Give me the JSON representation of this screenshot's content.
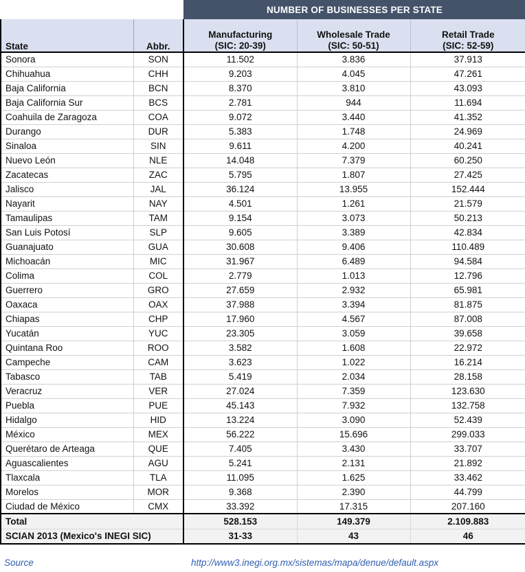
{
  "banner": {
    "title": "NUMBER OF BUSINESSES PER STATE"
  },
  "columns": {
    "state": "State",
    "abbr": "Abbr.",
    "manufacturing_line1": "Manufacturing",
    "manufacturing_line2": "(SIC: 20-39)",
    "wholesale_line1": "Wholesale Trade",
    "wholesale_line2": "(SIC: 50-51)",
    "retail_line1": "Retail Trade",
    "retail_line2": "(SIC: 52-59)"
  },
  "rows": [
    {
      "state": "Sonora",
      "abbr": "SON",
      "manufacturing": "11.502",
      "wholesale": "3.836",
      "retail": "37.913"
    },
    {
      "state": "Chihuahua",
      "abbr": "CHH",
      "manufacturing": "9.203",
      "wholesale": "4.045",
      "retail": "47.261"
    },
    {
      "state": "Baja California",
      "abbr": "BCN",
      "manufacturing": "8.370",
      "wholesale": "3.810",
      "retail": "43.093"
    },
    {
      "state": "Baja California Sur",
      "abbr": "BCS",
      "manufacturing": "2.781",
      "wholesale": "944",
      "retail": "11.694"
    },
    {
      "state": "Coahuila de Zaragoza",
      "abbr": "COA",
      "manufacturing": "9.072",
      "wholesale": "3.440",
      "retail": "41.352"
    },
    {
      "state": "Durango",
      "abbr": "DUR",
      "manufacturing": "5.383",
      "wholesale": "1.748",
      "retail": "24.969"
    },
    {
      "state": "Sinaloa",
      "abbr": "SIN",
      "manufacturing": "9.611",
      "wholesale": "4.200",
      "retail": "40.241"
    },
    {
      "state": "Nuevo León",
      "abbr": "NLE",
      "manufacturing": "14.048",
      "wholesale": "7.379",
      "retail": "60.250"
    },
    {
      "state": "Zacatecas",
      "abbr": "ZAC",
      "manufacturing": "5.795",
      "wholesale": "1.807",
      "retail": "27.425"
    },
    {
      "state": "Jalisco",
      "abbr": "JAL",
      "manufacturing": "36.124",
      "wholesale": "13.955",
      "retail": "152.444"
    },
    {
      "state": "Nayarit",
      "abbr": "NAY",
      "manufacturing": "4.501",
      "wholesale": "1.261",
      "retail": "21.579"
    },
    {
      "state": "Tamaulipas",
      "abbr": "TAM",
      "manufacturing": "9.154",
      "wholesale": "3.073",
      "retail": "50.213"
    },
    {
      "state": "San Luis Potosí",
      "abbr": "SLP",
      "manufacturing": "9.605",
      "wholesale": "3.389",
      "retail": "42.834"
    },
    {
      "state": "Guanajuato",
      "abbr": "GUA",
      "manufacturing": "30.608",
      "wholesale": "9.406",
      "retail": "110.489"
    },
    {
      "state": "Michoacán",
      "abbr": "MIC",
      "manufacturing": "31.967",
      "wholesale": "6.489",
      "retail": "94.584"
    },
    {
      "state": "Colima",
      "abbr": "COL",
      "manufacturing": "2.779",
      "wholesale": "1.013",
      "retail": "12.796"
    },
    {
      "state": "Guerrero",
      "abbr": "GRO",
      "manufacturing": "27.659",
      "wholesale": "2.932",
      "retail": "65.981"
    },
    {
      "state": "Oaxaca",
      "abbr": "OAX",
      "manufacturing": "37.988",
      "wholesale": "3.394",
      "retail": "81.875"
    },
    {
      "state": "Chiapas",
      "abbr": "CHP",
      "manufacturing": "17.960",
      "wholesale": "4.567",
      "retail": "87.008"
    },
    {
      "state": "Yucatán",
      "abbr": "YUC",
      "manufacturing": "23.305",
      "wholesale": "3.059",
      "retail": "39.658"
    },
    {
      "state": "Quintana Roo",
      "abbr": "ROO",
      "manufacturing": "3.582",
      "wholesale": "1.608",
      "retail": "22.972"
    },
    {
      "state": "Campeche",
      "abbr": "CAM",
      "manufacturing": "3.623",
      "wholesale": "1.022",
      "retail": "16.214"
    },
    {
      "state": "Tabasco",
      "abbr": "TAB",
      "manufacturing": "5.419",
      "wholesale": "2.034",
      "retail": "28.158"
    },
    {
      "state": "Veracruz",
      "abbr": "VER",
      "manufacturing": "27.024",
      "wholesale": "7.359",
      "retail": "123.630"
    },
    {
      "state": "Puebla",
      "abbr": "PUE",
      "manufacturing": "45.143",
      "wholesale": "7.932",
      "retail": "132.758"
    },
    {
      "state": "Hidalgo",
      "abbr": "HID",
      "manufacturing": "13.224",
      "wholesale": "3.090",
      "retail": "52.439"
    },
    {
      "state": "México",
      "abbr": "MEX",
      "manufacturing": "56.222",
      "wholesale": "15.696",
      "retail": "299.033"
    },
    {
      "state": "Querétaro de Arteaga",
      "abbr": "QUE",
      "manufacturing": "7.405",
      "wholesale": "3.430",
      "retail": "33.707"
    },
    {
      "state": "Aguascalientes",
      "abbr": "AGU",
      "manufacturing": "5.241",
      "wholesale": "2.131",
      "retail": "21.892"
    },
    {
      "state": "Tlaxcala",
      "abbr": "TLA",
      "manufacturing": "11.095",
      "wholesale": "1.625",
      "retail": "33.462"
    },
    {
      "state": "Morelos",
      "abbr": "MOR",
      "manufacturing": "9.368",
      "wholesale": "2.390",
      "retail": "44.799"
    },
    {
      "state": "Ciudad de México",
      "abbr": "CMX",
      "manufacturing": "33.392",
      "wholesale": "17.315",
      "retail": "207.160"
    }
  ],
  "totals": {
    "label": "Total",
    "manufacturing": "528.153",
    "wholesale": "149.379",
    "retail": "2.109.883"
  },
  "scian": {
    "label": "SCIAN 2013 (Mexico's INEGI SIC)",
    "manufacturing": "31-33",
    "wholesale": "43",
    "retail": "46"
  },
  "source": {
    "label": "Source",
    "url": "http://www3.inegi.org.mx/sistemas/mapa/denue/default.aspx"
  },
  "colors": {
    "banner_bg": "#44536a",
    "header_bg": "#dbe0f0",
    "total_bg": "#f2f2f2",
    "source_text": "#2f5fb3",
    "grid": "#d0d0d0"
  }
}
